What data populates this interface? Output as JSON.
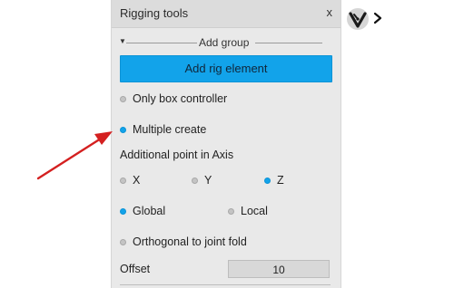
{
  "panel": {
    "title": "Rigging tools",
    "close_label": "x",
    "group_label": "Add group",
    "add_button_label": "Add rig element",
    "options": {
      "only_box_controller": {
        "label": "Only box controller",
        "selected": false
      },
      "multiple_create": {
        "label": "Multiple create",
        "selected": true
      }
    },
    "axis_heading": "Additional point in Axis",
    "axis_options": [
      {
        "label": "X",
        "selected": false
      },
      {
        "label": "Y",
        "selected": false
      },
      {
        "label": "Z",
        "selected": true
      }
    ],
    "space_options": [
      {
        "label": "Global",
        "selected": true
      },
      {
        "label": "Local",
        "selected": false
      }
    ],
    "orthogonal_label": "Orthogonal to joint fold",
    "offset_label": "Offset",
    "offset_value": "10"
  },
  "icons": {
    "tool_icon": "rig-tool-icon",
    "chevron": "chevron-right-icon",
    "annotation": "red-arrow-annotation"
  },
  "colors": {
    "accent": "#12a3ea",
    "panel_bg": "#e9e9e9",
    "annotation": "#d42020"
  }
}
